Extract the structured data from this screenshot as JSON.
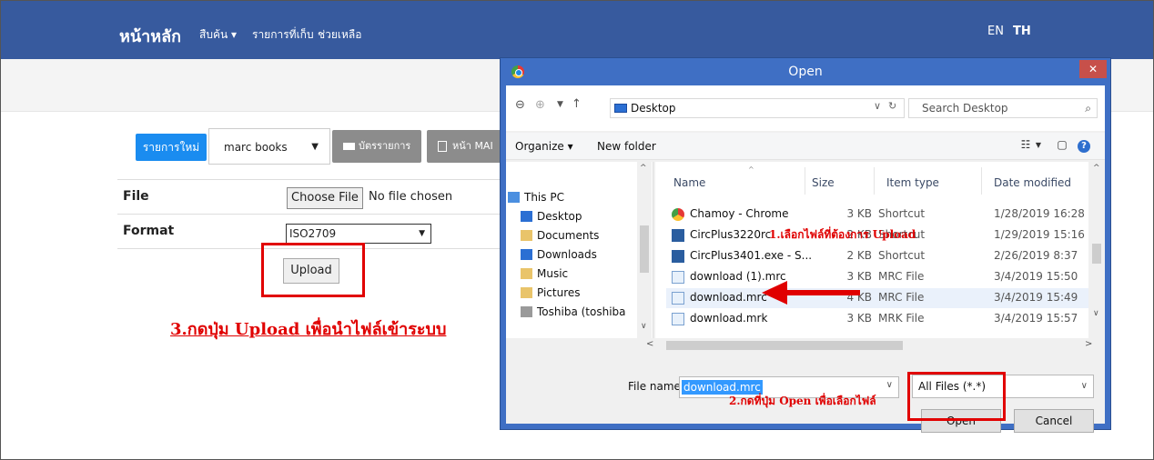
{
  "navbar": {
    "brand": "หน้าหลัก",
    "search_menu": "สืบค้น ▾",
    "saved_items": "รายการที่เก็บ",
    "help": "ช่วยเหลือ",
    "lang_en": "EN",
    "lang_th": "TH"
  },
  "toolbar": {
    "new_item": "รายการใหม่",
    "marc_select_value": "marc books",
    "catalog_btn": "บัตรรายการ",
    "marc_page_btn": "หน้า MAI"
  },
  "form": {
    "file_label": "File",
    "choose_file": "Choose File",
    "no_file": "No file chosen",
    "format_label": "Format",
    "format_value": "ISO2709",
    "upload_button": "Upload"
  },
  "annotations": {
    "step1": "1.เลือกไฟล์ที่ต้องการ Upload",
    "step2": "2.กดที่ปุ่ม Open เพื่อเลือกไฟล์",
    "step3": "3.กดปุ่ม Upload เพื่อนำไฟล์เข้าระบบ"
  },
  "dialog": {
    "title": "Open",
    "close_glyph": "✕",
    "address": "Desktop",
    "search_placeholder": "Search Desktop",
    "organize": "Organize ▾",
    "new_folder": "New folder",
    "nav_items": [
      {
        "label": "This PC"
      },
      {
        "label": "Desktop"
      },
      {
        "label": "Documents"
      },
      {
        "label": "Downloads"
      },
      {
        "label": "Music"
      },
      {
        "label": "Pictures"
      },
      {
        "label": "Toshiba (toshiba"
      }
    ],
    "columns": {
      "name": "Name",
      "size": "Size",
      "type": "Item type",
      "date": "Date modified"
    },
    "files": [
      {
        "name": "Chamoy - Chrome",
        "size": "3 KB",
        "type": "Shortcut",
        "date": "1/28/2019 16:28",
        "icon": "chrome-shortcut-icon"
      },
      {
        "name": "CircPlus3220rc",
        "size": "2 KB",
        "type": "Shortcut",
        "date": "1/29/2019 15:16",
        "icon": "app-shortcut-icon"
      },
      {
        "name": "CircPlus3401.exe - S...",
        "size": "2 KB",
        "type": "Shortcut",
        "date": "2/26/2019 8:37",
        "icon": "app-shortcut-icon"
      },
      {
        "name": "download (1).mrc",
        "size": "3 KB",
        "type": "MRC File",
        "date": "3/4/2019 15:50",
        "icon": "file-icon"
      },
      {
        "name": "download.mrc",
        "size": "4 KB",
        "type": "MRC File",
        "date": "3/4/2019 15:49",
        "icon": "file-icon"
      },
      {
        "name": "download.mrk",
        "size": "3 KB",
        "type": "MRK File",
        "date": "3/4/2019 15:57",
        "icon": "file-icon"
      }
    ],
    "filename_label": "File name:",
    "filename_value": "download.mrc",
    "filetype_value": "All Files (*.*)",
    "open_button": "Open",
    "cancel_button": "Cancel"
  },
  "colors": {
    "navbar": "#375a9e",
    "primary_button": "#1a8cf0",
    "annotation_red": "#e00000",
    "dialog_frame": "#3f6fc4"
  }
}
